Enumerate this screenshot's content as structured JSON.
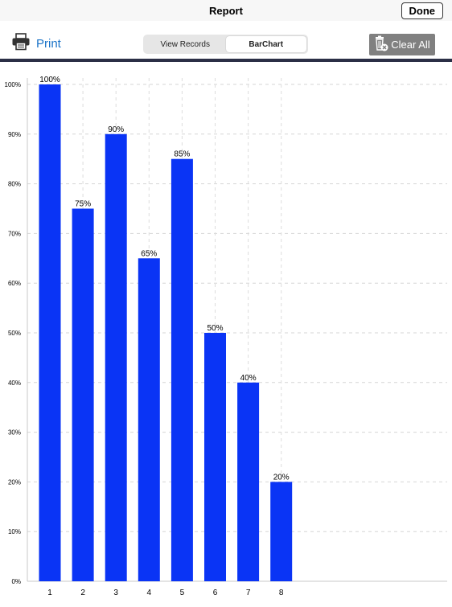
{
  "navbar": {
    "title": "Report",
    "done_label": "Done"
  },
  "toolbar": {
    "print_label": "Print",
    "segments": [
      {
        "label": "View Records",
        "selected": false
      },
      {
        "label": "BarChart",
        "selected": true
      }
    ],
    "clear_label": "Clear All"
  },
  "colors": {
    "bar": "#0a34f5",
    "accent": "#1a73c8",
    "divider": "#2b2f46",
    "clear_button": "#808080"
  },
  "chart_data": {
    "type": "bar",
    "categories": [
      "1",
      "2",
      "3",
      "4",
      "5",
      "6",
      "7",
      "8"
    ],
    "values": [
      100,
      75,
      90,
      65,
      85,
      50,
      40,
      20
    ],
    "data_labels": [
      "100%",
      "75%",
      "90%",
      "65%",
      "85%",
      "50%",
      "40%",
      "20%"
    ],
    "yticks": [
      "0%",
      "10%",
      "20%",
      "30%",
      "40%",
      "50%",
      "60%",
      "70%",
      "80%",
      "90%",
      "100%"
    ],
    "ylim": [
      0,
      100
    ],
    "grid": true
  }
}
